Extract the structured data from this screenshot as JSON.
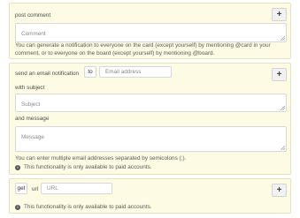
{
  "post_comment": {
    "label": "post comment",
    "comment_placeholder": "Comment",
    "help": "You can generate a notification to everyone on the card (except yourself) by mentioning @card in your comment, or to everyone on the board (except yourself) by mentioning @board.",
    "add_button": "+"
  },
  "email": {
    "label": "send an email notification",
    "to_label": "to",
    "address_placeholder": "Email address",
    "subject_label": "with subject",
    "subject_placeholder": "Subject",
    "message_label": "and message",
    "message_placeholder": "Message",
    "help": "You can enter multiple email addresses separated by semicolons (;).",
    "paid_note": "This functionality is only available to paid accounts.",
    "add_button": "+"
  },
  "http": {
    "method": "get",
    "url_label": "url",
    "url_placeholder": "URL",
    "paid_note": "This functionality is only available to paid accounts.",
    "add_button": "+"
  }
}
